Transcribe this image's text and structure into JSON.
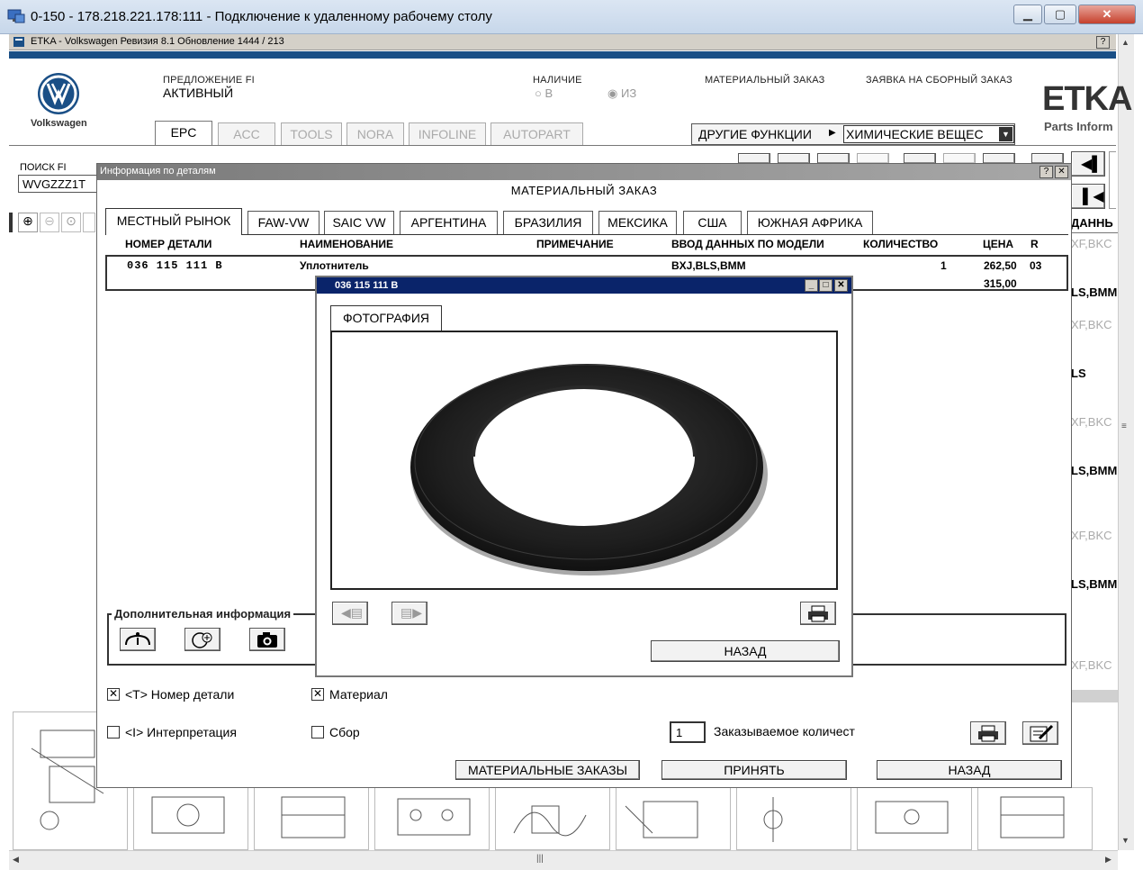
{
  "rdp": {
    "title": "0-150 - 178.218.221.178:111 - Подключение к удаленному рабочему столу"
  },
  "etka": {
    "title": "ETKA - Volkswagen Ревизия 8.1 Обновление 1444 / 213",
    "help": "?"
  },
  "header": {
    "brand": "Volkswagen",
    "offer_label": "ПРЕДЛОЖЕНИЕ FI",
    "offer_value": "АКТИВНЫЙ",
    "availability_label": "НАЛИЧИЕ",
    "radio_b": "В",
    "radio_iz": "ИЗ",
    "material_order": "МАТЕРИАЛЬНЫЙ ЗАКАЗ",
    "assembly_order": "ЗАЯВКА НА СБОРНЫЙ ЗАКАЗ",
    "etka_logo": "ETKA",
    "etka_sub": "Parts Inform",
    "other_functions": "ДРУГИЕ ФУНКЦИИ",
    "chemicals": "ХИМИЧЕСКИЕ ВЕЩЕС",
    "tabs": [
      "EPC",
      "ACC",
      "TOOLS",
      "NORA",
      "INFOLINE",
      "AUTOPART"
    ],
    "search_label": "ПОИСК FI",
    "search_value": "WVGZZZ1T"
  },
  "right_strip": {
    "header": "ДАННЬ",
    "rows": [
      "XF,BKC",
      "LS,BMM",
      "XF,BKC",
      "LS",
      "XF,BKC",
      "LS,BMM",
      "XF,BKC",
      "LS,BMM",
      "XF,BKC"
    ]
  },
  "dialog": {
    "title": "Информация по деталям",
    "heading": "МАТЕРИАЛЬНЫЙ ЗАКАЗ",
    "tabs": [
      "МЕСТНЫЙ РЫНОК",
      "FAW-VW",
      "SAIC VW",
      "АРГЕНТИНА",
      "БРАЗИЛИЯ",
      "МЕКСИКА",
      "США",
      "ЮЖНАЯ АФРИКА"
    ],
    "columns": [
      "НОМЕР ДЕТАЛИ",
      "НАИМЕНОВАНИЕ",
      "ПРИМЕЧАНИЕ",
      "ВВОД ДАННЫХ ПО МОДЕЛИ",
      "КОЛИЧЕСТВО",
      "ЦЕНА",
      "R"
    ],
    "row": {
      "part_no": "036 115 111 B",
      "name": "Уплотнитель",
      "model": "BXJ,BLS,BMM",
      "qty": "1",
      "price1": "262,50",
      "price2": "315,00",
      "r": "03"
    },
    "extra_info": "Дополнительная информация",
    "chk_part_no": "<T> Номер детали",
    "chk_material": "Материал",
    "chk_interp": "<I> Интерпретация",
    "chk_assembly": "Сбор",
    "order_qty_value": "1",
    "order_qty_label": "Заказываемое количест",
    "btn_material_orders": "МАТЕРИАЛЬНЫЕ ЗАКАЗЫ",
    "btn_accept": "ПРИНЯТЬ",
    "btn_back": "НАЗАД"
  },
  "photo": {
    "title": "036 115 111 B",
    "tab": "ФОТОГРАФИЯ",
    "btn_back": "НАЗАД"
  }
}
